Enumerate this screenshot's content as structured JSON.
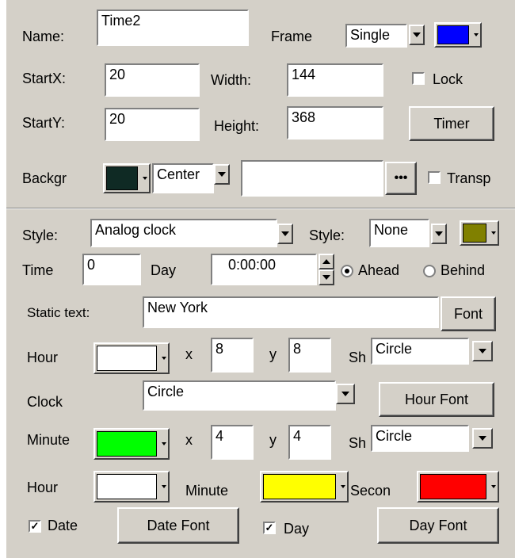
{
  "name": {
    "label": "Name:",
    "value": "Time2"
  },
  "frame": {
    "label": "Frame",
    "selected": "Single",
    "color": "#0000ff"
  },
  "startx": {
    "label": "StartX:",
    "value": "20"
  },
  "width": {
    "label": "Width:",
    "value": "144"
  },
  "lock": {
    "label": "Lock",
    "checked": false
  },
  "starty": {
    "label": "StartY:",
    "value": "20"
  },
  "height": {
    "label": "Height:",
    "value": "368"
  },
  "timer_button": "Timer",
  "background": {
    "label": "Backgr",
    "color": "#0f2a24",
    "align": "Center",
    "image_value": "",
    "browse": "•••",
    "transparent_label": "Transp",
    "transparent_checked": false
  },
  "style": {
    "label": "Style:",
    "selected": "Analog clock",
    "label2": "Style:",
    "selected2": "None",
    "color": "#808000"
  },
  "time": {
    "label": "Time",
    "value": "0",
    "day_label": "Day",
    "day_value": "0:00:00",
    "ahead_label": "Ahead",
    "behind_label": "Behind",
    "selected": "Ahead"
  },
  "static_text": {
    "label": "Static text:",
    "value": "New York",
    "font_button": "Font"
  },
  "hour_row": {
    "label": "Hour",
    "color": "#ffffff",
    "x_label": "x",
    "x_value": "8",
    "y_label": "y",
    "y_value": "8",
    "sh_label": "Sh",
    "shape": "Circle"
  },
  "clock_row": {
    "label": "Clock",
    "shape": "Circle",
    "hour_font_button": "Hour Font"
  },
  "minute_row": {
    "label": "Minute",
    "color": "#00ff00",
    "x_label": "x",
    "x_value": "4",
    "y_label": "y",
    "y_value": "4",
    "sh_label": "Sh",
    "shape": "Circle"
  },
  "hands_row": {
    "hour_label": "Hour",
    "hour_color": "#ffffff",
    "minute_label": "Minute",
    "minute_color": "#ffff00",
    "second_label": "Secon",
    "second_color": "#ff0000"
  },
  "date_row": {
    "date_label": "Date",
    "date_checked": true,
    "date_font_button": "Date Font",
    "day_label": "Day",
    "day_checked": true,
    "day_font_button": "Day Font"
  }
}
